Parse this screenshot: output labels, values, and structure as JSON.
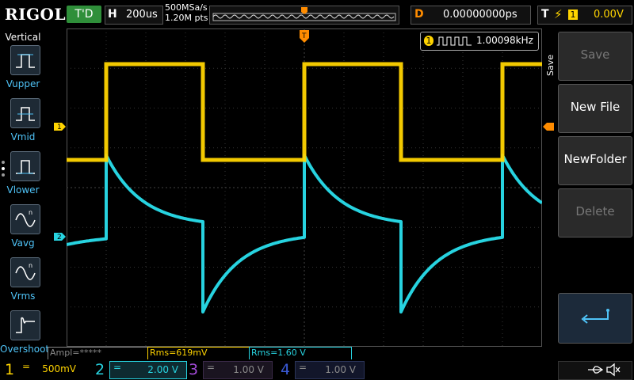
{
  "brand": "RIGOL",
  "top": {
    "trigger_status": "T'D",
    "horizontal_key": "H",
    "timebase": "200us",
    "sample_rate": "500MSa/s",
    "points": "1.20M pts",
    "delay_key": "D",
    "delay": "0.00000000ps",
    "trigger_key": "T",
    "trigger_channel": "1",
    "trigger_level": "0.00V"
  },
  "left_panel": {
    "title": "Vertical",
    "items": [
      {
        "label": "Vupper",
        "icon": "vupper-icon"
      },
      {
        "label": "Vmid",
        "icon": "vmid-icon"
      },
      {
        "label": "Vlower",
        "icon": "vlower-icon"
      },
      {
        "label": "Vavg",
        "icon": "vavg-icon"
      },
      {
        "label": "Vrms",
        "icon": "vrms-icon"
      },
      {
        "label": "Overshoot",
        "icon": "overshoot-icon"
      }
    ]
  },
  "frequency": {
    "channel": "1",
    "value": "1.00098kHz"
  },
  "menu": {
    "side_label": "Save",
    "items": [
      {
        "label": "Save",
        "enabled": false
      },
      {
        "label": "New File",
        "enabled": true
      },
      {
        "label": "NewFolder",
        "enabled": true
      },
      {
        "label": "Delete",
        "enabled": false
      }
    ],
    "enter_icon": "enter-icon"
  },
  "readouts": {
    "ampl": "Ampl=*****",
    "rms1": "Rms=619mV",
    "rms2": "Rms=1.60 V"
  },
  "channels": [
    {
      "num": "1",
      "coupling": "=",
      "scale": "500mV",
      "color": "#ffd400",
      "active": true
    },
    {
      "num": "2",
      "coupling": "=",
      "scale": "2.00 V",
      "color": "#27d3e0",
      "active": true
    },
    {
      "num": "3",
      "coupling": "=",
      "scale": "1.00 V",
      "color": "#a34bd8",
      "active": false
    },
    {
      "num": "4",
      "coupling": "=",
      "scale": "1.00 V",
      "color": "#3a5bd8",
      "active": false
    }
  ],
  "markers": {
    "ch1": "1",
    "ch2": "2"
  },
  "status_icons": [
    "usb-icon",
    "speaker-mute-icon"
  ],
  "colors": {
    "ch1": "#ffd400",
    "ch2": "#27d3e0",
    "trigger": "#ff8c00"
  }
}
